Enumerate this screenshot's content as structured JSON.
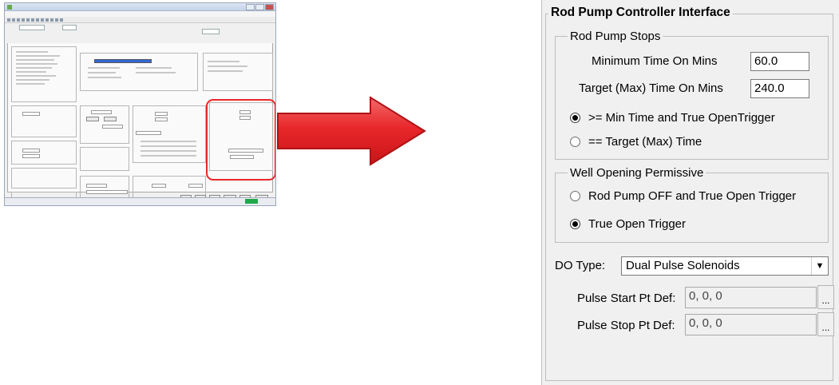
{
  "panel": {
    "title": "Rod Pump Controller Interface",
    "stops_group": {
      "title": "Rod Pump Stops",
      "min_time_label": "Minimum Time On Mins",
      "min_time_value": "60.0",
      "target_time_label": "Target (Max) Time On Mins",
      "target_time_value": "240.0",
      "options": [
        {
          "label": ">= Min Time and True OpenTrigger",
          "selected": true
        },
        {
          "label": "== Target (Max) Time",
          "selected": false
        }
      ]
    },
    "permissive_group": {
      "title": "Well Opening Permissive",
      "options": [
        {
          "label": "Rod Pump OFF and True Open Trigger",
          "selected": false
        },
        {
          "label": "True Open Trigger",
          "selected": true
        }
      ]
    },
    "do_type": {
      "label": "DO Type:",
      "value": "Dual Pulse Solenoids",
      "dropdown_icon": "triangle-down"
    },
    "pulse_start": {
      "label": "Pulse Start Pt Def:",
      "value": "0, 0, 0",
      "button": "..."
    },
    "pulse_stop": {
      "label": "Pulse Stop Pt Def:",
      "value": "0, 0, 0",
      "button": "..."
    }
  },
  "colors": {
    "highlight": "#e8272b",
    "arrow": "#e8272b",
    "panel_bg": "#f0f0f0"
  }
}
